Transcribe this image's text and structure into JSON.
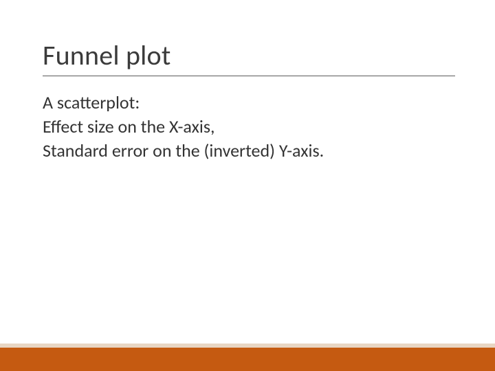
{
  "slide": {
    "title": "Funnel plot",
    "body": {
      "line1": "A scatterplot:",
      "line2": "Effect size on the X-axis,",
      "line3": "Standard error on the (inverted) Y-axis."
    }
  },
  "theme": {
    "accent": "#c55a11",
    "accent_light": "#e8d6c3",
    "text": "#333333",
    "title_color": "#3b3b3b"
  }
}
